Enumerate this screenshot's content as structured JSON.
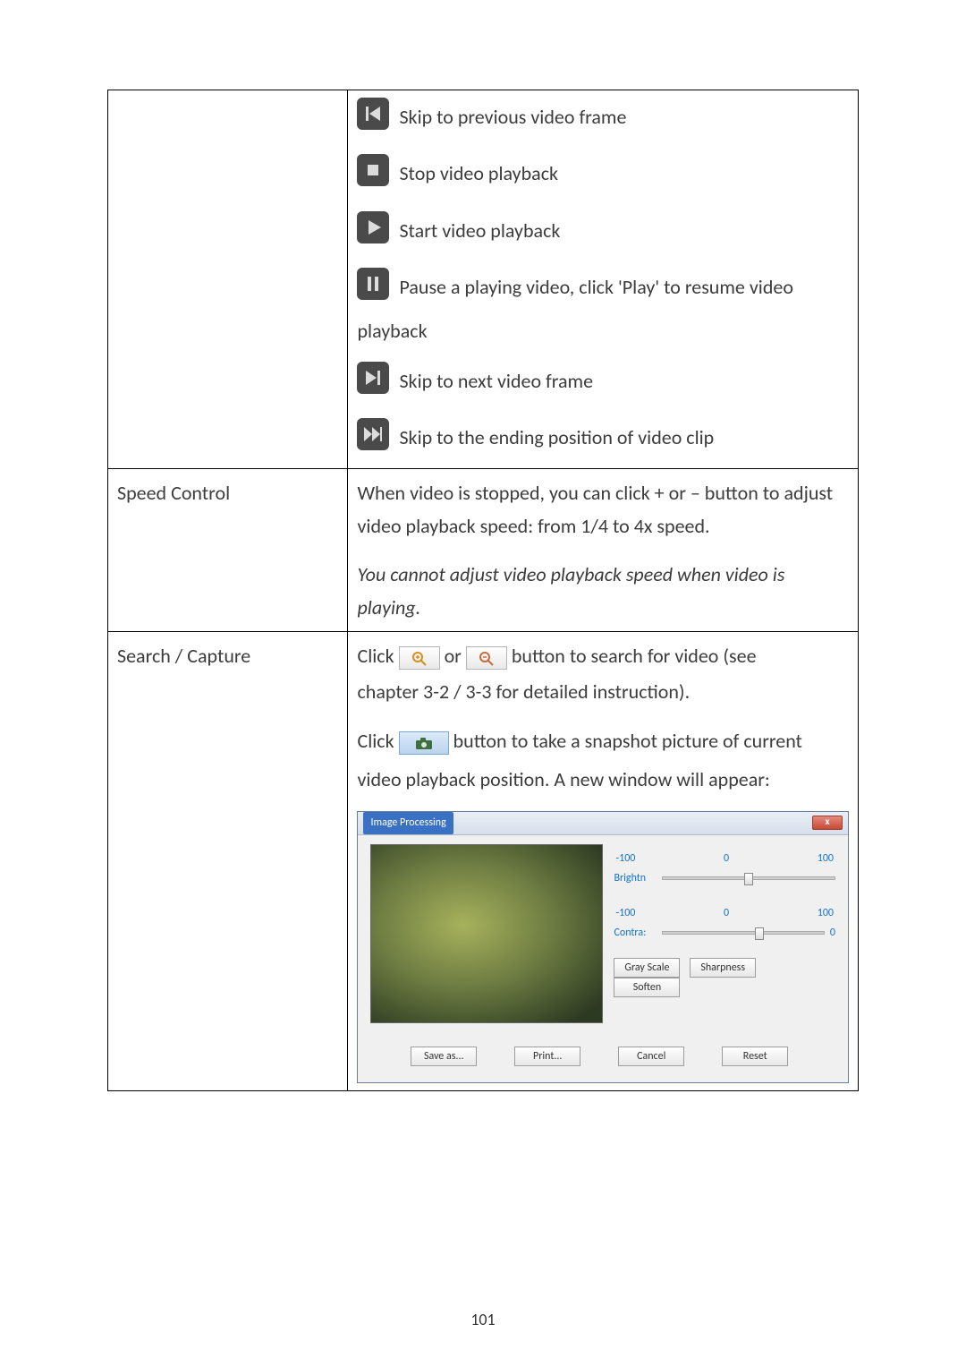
{
  "rows": {
    "playback": {
      "skipPrev": "Skip to previous video frame",
      "stop": "Stop video playback",
      "start": "Start video playback",
      "pause1": "Pause a playing video, click 'Play' to resume video",
      "pause2": "playback",
      "skipNext": "Skip to next video frame",
      "skipEnd": "Skip to the ending position of video clip"
    },
    "speed": {
      "label": "Speed Control",
      "p1": "When video is stopped, you can click + or – button to adjust video playback speed: from 1/4 to 4x speed.",
      "p2": "You cannot adjust video playback speed when video is playing."
    },
    "search": {
      "label": "Search / Capture",
      "l1a": "Click",
      "l1b": "or",
      "l1c": "button to search for video (see",
      "l2": "chapter 3-2 / 3-3 for detailed instruction).",
      "l3a": "Click",
      "l3b": "button to take a snapshot picture of current",
      "l4": "video playback position. A new window will appear:"
    }
  },
  "dialog": {
    "title": "Image Processing",
    "close": "x",
    "sliders": {
      "brightness": {
        "label": "Brightn",
        "min": "-100",
        "mid": "0",
        "max": "100"
      },
      "contrast": {
        "label": "Contra:",
        "min": "-100",
        "mid": "0",
        "max": "100"
      }
    },
    "buttons": {
      "gray": "Gray Scale",
      "sharp": "Sharpness",
      "soften": "Soften",
      "save": "Save as...",
      "print": "Print...",
      "cancel": "Cancel",
      "reset": "Reset"
    },
    "contrastEnd": "0"
  },
  "pageNumber": "101"
}
